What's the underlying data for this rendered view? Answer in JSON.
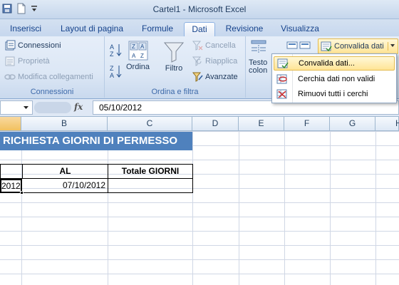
{
  "window": {
    "title": "Cartel1 - Microsoft Excel"
  },
  "tabs": [
    {
      "label": "Inserisci"
    },
    {
      "label": "Layout di pagina"
    },
    {
      "label": "Formule"
    },
    {
      "label": "Dati",
      "active": true
    },
    {
      "label": "Revisione"
    },
    {
      "label": "Visualizza"
    }
  ],
  "ribbon": {
    "connections_group": {
      "label": "Connessioni",
      "connections": "Connessioni",
      "properties": "Proprietà",
      "edit_links": "Modifica collegamenti"
    },
    "sort_filter_group": {
      "label": "Ordina e filtra",
      "sort": "Ordina",
      "filter": "Filtro",
      "clear": "Cancella",
      "reapply": "Riapplica",
      "advanced": "Avanzate"
    },
    "data_tools": {
      "text_to_columns_1": "Testo",
      "text_to_columns_2": "colon",
      "validation": "Convalida dati"
    }
  },
  "validation_menu": {
    "items": [
      {
        "label": "Convalida dati...",
        "icon": "validation-icon",
        "highlighted": true
      },
      {
        "label": "Cerchia dati non validi",
        "icon": "circle-invalid-icon"
      },
      {
        "label": "Rimuovi tutti i cerchi",
        "icon": "remove-circles-icon"
      }
    ]
  },
  "formula_bar": {
    "fx": "fx",
    "value": "05/10/2012"
  },
  "columns": [
    "B",
    "C",
    "D",
    "E",
    "F",
    "G",
    "H"
  ],
  "sheet": {
    "title": "RICHIESTA GIORNI DI PERMESSO",
    "header_al": "AL",
    "header_total": "Totale GIORNI",
    "a_value": "2012",
    "b_value": "07/10/2012"
  },
  "colors": {
    "title_fill": "#4f81bd",
    "active_tab": "#ffffff",
    "menu_highlight": "#ffe495"
  }
}
